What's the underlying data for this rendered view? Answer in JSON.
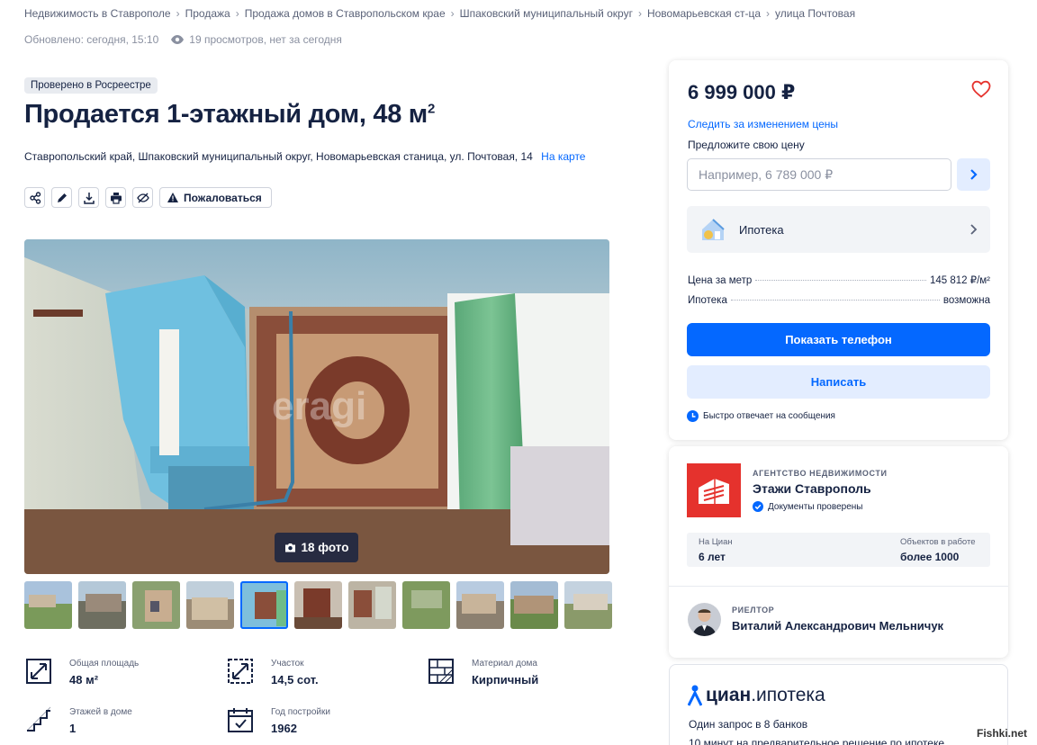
{
  "breadcrumbs": [
    "Недвижимость в Ставрополе",
    "Продажа",
    "Продажа домов в Ставропольском крае",
    "Шпаковский муниципальный округ",
    "Новомарьевская ст-ца",
    "улица Почтовая"
  ],
  "meta": {
    "updated": "Обновлено: сегодня, 15:10",
    "views": "19 просмотров, нет за сегодня"
  },
  "badge": "Проверено в Росреестре",
  "title": {
    "text": "Продается 1-этажный дом, 48 м",
    "sup": "2"
  },
  "address": {
    "text": "Ставропольский край, Шпаковский муниципальный округ, Новомарьевская станица, ул. Почтовая, 14",
    "map_link": "На карте"
  },
  "toolbar": {
    "complain_label": "Пожаловаться"
  },
  "gallery": {
    "photo_count": "18 фото",
    "photo_watermark": "eragi",
    "active_thumb": 5
  },
  "facts": [
    {
      "label": "Общая площадь",
      "value": "48 м²",
      "icon": "area-icon"
    },
    {
      "label": "Участок",
      "value": "14,5 сот.",
      "icon": "plot-icon"
    },
    {
      "label": "Материал дома",
      "value": "Кирпичный",
      "icon": "brick-icon"
    },
    {
      "label": "Этажей в доме",
      "value": "1",
      "icon": "stairs-icon"
    },
    {
      "label": "Год постройки",
      "value": "1962",
      "icon": "calendar-icon"
    }
  ],
  "price_card": {
    "price": "6 999 000 ₽",
    "follow_price": "Следить за изменением цены",
    "offer_label": "Предложите свою цену",
    "offer_placeholder": "Например, 6 789 000 ₽",
    "mortgage": "Ипотека",
    "rows": [
      {
        "label": "Цена за метр",
        "value": "145 812 ₽/м²"
      },
      {
        "label": "Ипотека",
        "value": "возможна"
      }
    ],
    "show_phone": "Показать телефон",
    "write": "Написать",
    "fast_reply": "Быстро отвечает на сообщения"
  },
  "agency": {
    "type": "АГЕНТСТВО НЕДВИЖИМОСТИ",
    "name": "Этажи Ставрополь",
    "verified": "Документы проверены",
    "stat1_label": "На Циан",
    "stat1_value": "6 лет",
    "stat2_label": "Объектов в работе",
    "stat2_value": "более 1000",
    "realtor_role": "РИЕЛТОР",
    "realtor_name": "Виталий Александрович Мельничук"
  },
  "cian": {
    "logo_bold": "циан",
    "logo_rest": ".ипотека",
    "line1": "Один запрос в 8 банков",
    "line2": "10 минут на предварительное решение по ипотеке"
  },
  "watermark": "Fishki.net",
  "colors": {
    "accent": "#0468ff",
    "text": "#152242",
    "agency_red": "#e5322d"
  }
}
